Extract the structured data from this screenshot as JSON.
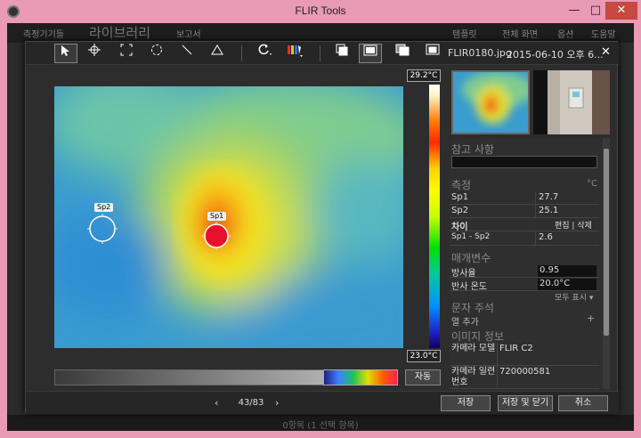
{
  "window": {
    "title": "FLIR Tools",
    "minimize": "—",
    "maximize": "□",
    "close": "✕"
  },
  "app_menu": {
    "item1": "측정기기들",
    "library": "라이브러리",
    "report": "보고서",
    "template": "템플릿",
    "fullscreen": "전체 화면",
    "options": "옵션",
    "help": "도움말"
  },
  "dialog": {
    "filename": "FLIR0180.jpg",
    "date": "2015-06-10 오후 6...",
    "close": "✕",
    "scale": {
      "max": "29.2°C",
      "min": "23.0°C"
    },
    "auto_button": "자동",
    "pager": {
      "prev": "‹",
      "text": "43/83",
      "next": "›"
    },
    "buttons": {
      "save": "저장",
      "save_close": "저장 및 닫기",
      "cancel": "취소"
    },
    "spots": {
      "sp1": "Sp1",
      "sp2": "Sp2"
    }
  },
  "panel": {
    "notes_title": "참고 사항",
    "measure_title": "측정",
    "measure_unit": "°C",
    "measurements": [
      {
        "label": "Sp1",
        "value": "27.7"
      },
      {
        "label": "Sp2",
        "value": "25.1"
      }
    ],
    "diff_label": "차이",
    "diff_actions": "편집 | 삭제",
    "diff_row": {
      "label": "Sp1 - Sp2",
      "value": "2.6"
    },
    "params_title": "매개변수",
    "params": [
      {
        "label": "방사율",
        "value": "0.95"
      },
      {
        "label": "반사 온도",
        "value": "20.0°C"
      }
    ],
    "show_all": "모두 표시 ▾",
    "text_annotation_title": "문자 주석",
    "add_column": "열 추가",
    "add_plus": "+",
    "image_info_title": "이미지 정보",
    "image_info": [
      {
        "label": "카메라 모델",
        "value": "FLIR C2"
      },
      {
        "label": "카메라 일련 번호",
        "value": "720000581"
      }
    ]
  },
  "status": {
    "text": "0항목 (1 선택 항목)"
  }
}
